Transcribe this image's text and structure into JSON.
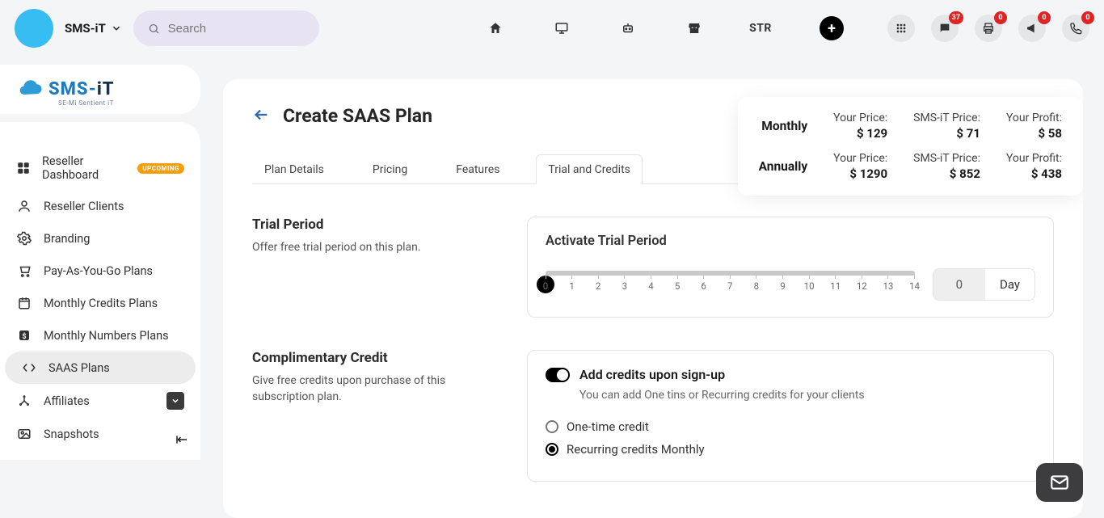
{
  "top": {
    "brand": "SMS-iT",
    "search_placeholder": "Search",
    "nav_text": "STR",
    "badges": {
      "chat": "37",
      "print": "0",
      "promo": "0",
      "phone": "0"
    }
  },
  "logo": {
    "part1": "SMS-",
    "part2": "iT",
    "tagline": "SE-Mi Sentient iT"
  },
  "sidebar": {
    "items": [
      {
        "label": "Reseller Dashboard",
        "tag": "UPCOMING"
      },
      {
        "label": "Reseller Clients"
      },
      {
        "label": "Branding"
      },
      {
        "label": "Pay-As-You-Go Plans"
      },
      {
        "label": "Monthly Credits Plans"
      },
      {
        "label": "Monthly Numbers Plans"
      },
      {
        "label": "SAAS Plans"
      },
      {
        "label": "Affiliates",
        "expand": true
      },
      {
        "label": "Snapshots"
      }
    ]
  },
  "page": {
    "title": "Create SAAS Plan",
    "tabs": [
      "Plan Details",
      "Pricing",
      "Features",
      "Trial and Credits"
    ],
    "active_tab": 3
  },
  "pricing": {
    "row1_label": "Monthly",
    "row2_label": "Annually",
    "col_your": "Your Price:",
    "col_smsit": "SMS-iT Price:",
    "col_profit": "Your Profit:",
    "monthly": {
      "your": "$ 129",
      "smsit": "$ 71",
      "profit": "$ 58"
    },
    "annually": {
      "your": "$ 1290",
      "smsit": "$ 852",
      "profit": "$ 438"
    }
  },
  "trial": {
    "header": "Trial Period",
    "desc": "Offer free trial period on this plan.",
    "card_title": "Activate Trial Period",
    "ticks": [
      "0",
      "1",
      "2",
      "3",
      "4",
      "5",
      "6",
      "7",
      "8",
      "9",
      "10",
      "11",
      "12",
      "13",
      "14"
    ],
    "value": "0",
    "unit": "Day"
  },
  "credit": {
    "header": "Complimentary Credit",
    "desc": "Give free credits upon purchase of this subscription plan.",
    "toggle_label": "Add credits upon sign-up",
    "toggle_sub": "You can add One tins or Recurring credits for your clients",
    "opt_one": "One-time credit",
    "opt_recurring": "Recurring credits Monthly"
  }
}
